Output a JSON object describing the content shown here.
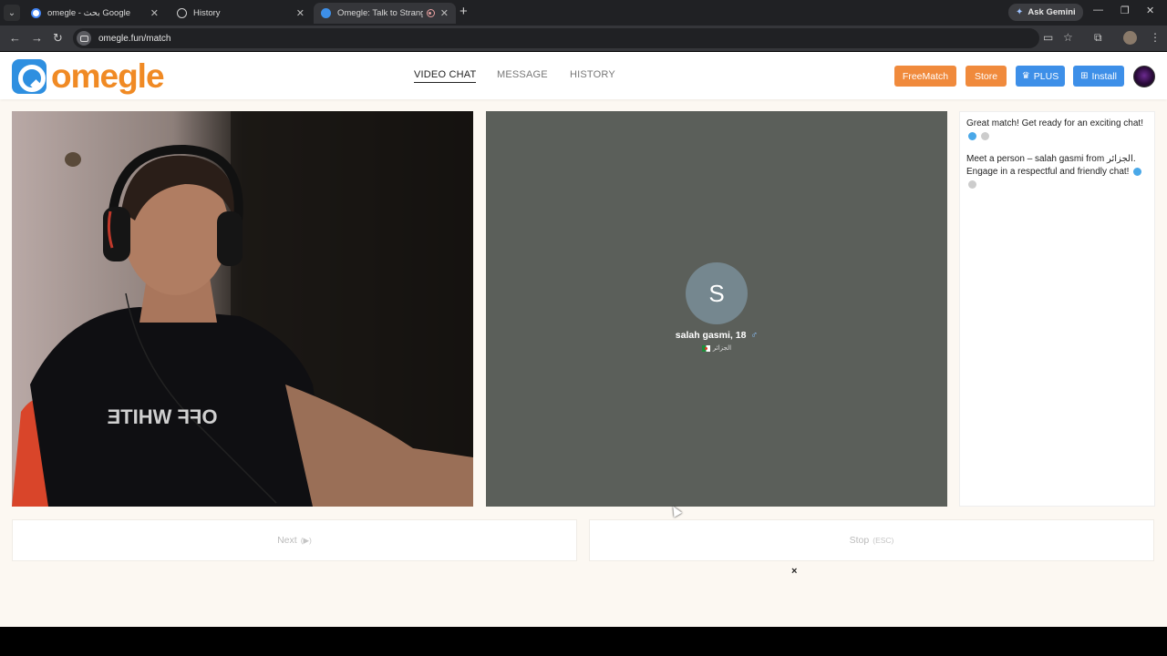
{
  "browser": {
    "tabs": [
      {
        "label": "omegle - بحث Google",
        "favicon_color": "#4285f4",
        "active": false
      },
      {
        "label": "History",
        "favicon_color": "#888888",
        "active": false
      },
      {
        "label": "Omegle: Talk to Strangers!",
        "favicon_color": "#3d8fe8",
        "active": true
      }
    ],
    "new_tab": "+",
    "gemini_label": "Ask Gemini",
    "url": "omegle.fun/match"
  },
  "header": {
    "logo_text": "omegle",
    "nav": [
      {
        "label": "VIDEO CHAT",
        "active": true
      },
      {
        "label": "MESSAGE",
        "active": false
      },
      {
        "label": "HISTORY",
        "active": false
      }
    ],
    "buttons": {
      "freematch": "FreeMatch",
      "store": "Store",
      "plus": "PLUS",
      "install": "Install"
    }
  },
  "remote": {
    "initial": "S",
    "name": "salah gasmi, 18",
    "gender_symbol": "♂",
    "country": "الجزائر"
  },
  "self_video": {
    "shirt_text": "OFF WHITE"
  },
  "chat": {
    "messages": [
      "Great match! Get ready for an exciting chat!",
      "Meet a person – salah gasmi from الجزائر. Engage in a respectful and friendly chat!"
    ]
  },
  "controls": {
    "next_label": "Next",
    "next_hint": "(▶)",
    "stop_label": "Stop",
    "stop_hint": "(ESC)",
    "close": "×"
  },
  "colors": {
    "brand_orange": "#f08a24",
    "brand_blue": "#2e8fe0",
    "page_bg": "#fcf8f2",
    "remote_bg": "#5b5f5a"
  }
}
